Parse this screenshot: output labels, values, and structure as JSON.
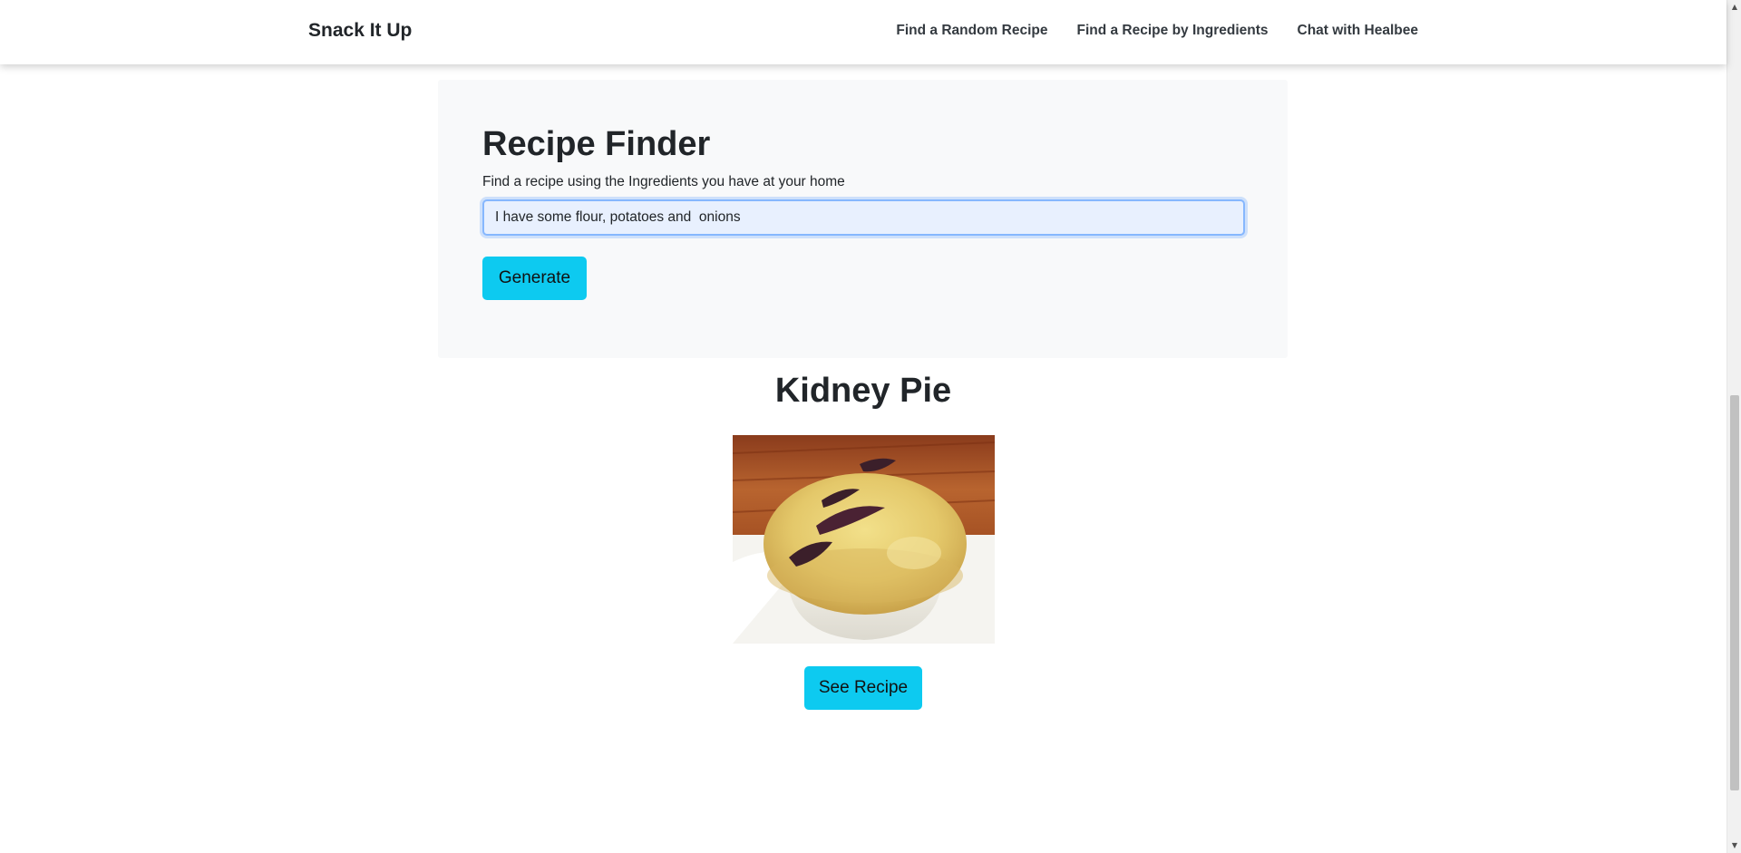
{
  "navbar": {
    "brand": "Snack It Up",
    "links": [
      "Find a Random Recipe",
      "Find a Recipe by Ingredients",
      "Chat with Healbee"
    ]
  },
  "finder": {
    "title": "Recipe Finder",
    "subtitle": "Find a recipe using the Ingredients you have at your home",
    "input_value": "I have some flour, potatoes and  onions",
    "generate_label": "Generate"
  },
  "result": {
    "title": "Kidney Pie",
    "see_recipe_label": "See Recipe"
  },
  "colors": {
    "accent": "#0dcaf0",
    "card_bg": "#f8f9fa",
    "focus_border": "#86b7fe"
  },
  "icons": {
    "scroll_up": "chevron-up-icon",
    "scroll_down": "chevron-down-icon"
  }
}
